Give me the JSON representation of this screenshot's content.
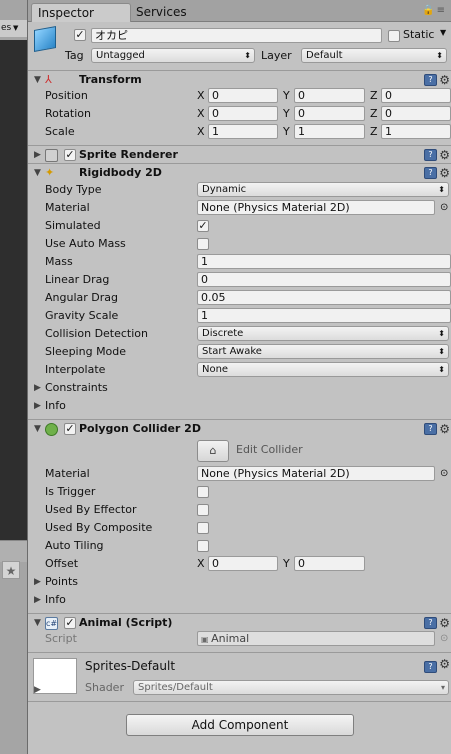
{
  "tabs": {
    "inspector": "Inspector",
    "services": "Services"
  },
  "object": {
    "name": "オカピ",
    "static_label": "Static",
    "tag_label": "Tag",
    "tag_value": "Untagged",
    "layer_label": "Layer",
    "layer_value": "Default"
  },
  "transform": {
    "title": "Transform",
    "position_label": "Position",
    "rotation_label": "Rotation",
    "scale_label": "Scale",
    "position": {
      "x": "0",
      "y": "0",
      "z": "0"
    },
    "rotation": {
      "x": "0",
      "y": "0",
      "z": "0"
    },
    "scale": {
      "x": "1",
      "y": "1",
      "z": "1"
    },
    "axis": {
      "x": "X",
      "y": "Y",
      "z": "Z"
    }
  },
  "sprite_renderer": {
    "title": "Sprite Renderer"
  },
  "rigidbody": {
    "title": "Rigidbody 2D",
    "body_type_label": "Body Type",
    "body_type": "Dynamic",
    "material_label": "Material",
    "material": "None (Physics Material 2D)",
    "simulated_label": "Simulated",
    "simulated": true,
    "use_auto_mass_label": "Use Auto Mass",
    "use_auto_mass": false,
    "mass_label": "Mass",
    "mass": "1",
    "linear_drag_label": "Linear Drag",
    "linear_drag": "0",
    "angular_drag_label": "Angular Drag",
    "angular_drag": "0.05",
    "gravity_scale_label": "Gravity Scale",
    "gravity_scale": "1",
    "collision_detection_label": "Collision Detection",
    "collision_detection": "Discrete",
    "sleeping_mode_label": "Sleeping Mode",
    "sleeping_mode": "Start Awake",
    "interpolate_label": "Interpolate",
    "interpolate": "None",
    "constraints_label": "Constraints",
    "info_label": "Info"
  },
  "polygon_collider": {
    "title": "Polygon Collider 2D",
    "edit_collider": "Edit Collider",
    "material_label": "Material",
    "material": "None (Physics Material 2D)",
    "is_trigger_label": "Is Trigger",
    "used_by_effector_label": "Used By Effector",
    "used_by_composite_label": "Used By Composite",
    "auto_tiling_label": "Auto Tiling",
    "offset_label": "Offset",
    "offset": {
      "x": "0",
      "y": "0"
    },
    "points_label": "Points",
    "info_label": "Info"
  },
  "animal_script": {
    "title": "Animal (Script)",
    "script_label": "Script",
    "script_value": "Animal"
  },
  "material_section": {
    "name": "Sprites-Default",
    "shader_label": "Shader",
    "shader_value": "Sprites/Default"
  },
  "add_component": "Add Component",
  "colors": {
    "accent": "#4a6fa5",
    "panel": "#c2c2c2"
  }
}
